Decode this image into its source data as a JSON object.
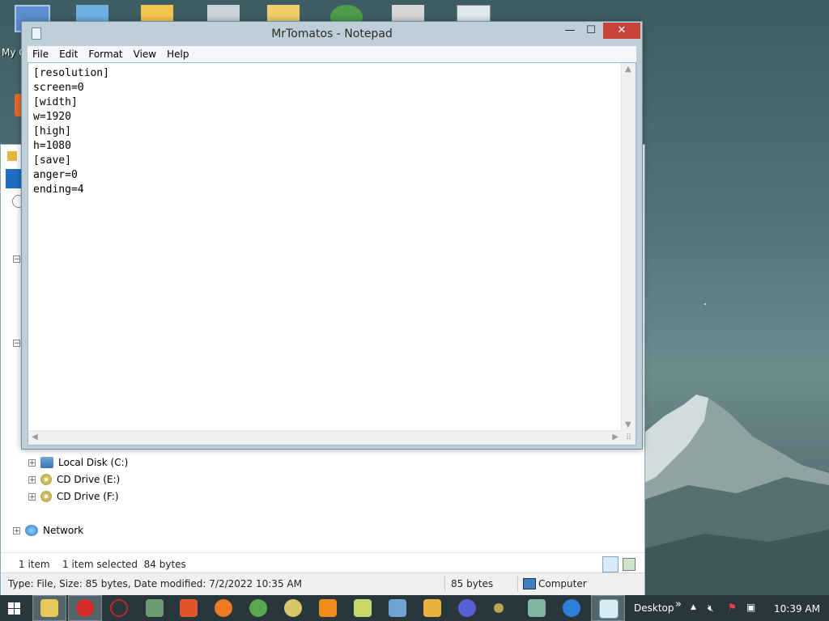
{
  "desktop": {
    "partial_label": "My C",
    "icons": [
      "computer-icon",
      "control-panel-icon",
      "folder-icon",
      "recycle-bin-icon",
      "documents-folder-icon",
      "network-globe-icon",
      "scanner-icon",
      "window-icon"
    ]
  },
  "explorer": {
    "tree": [
      {
        "label": "Local Disk (C:)",
        "icon": "hard-disk-icon"
      },
      {
        "label": "CD Drive (E:)",
        "icon": "cd-drive-icon"
      },
      {
        "label": "CD Drive (F:)",
        "icon": "cd-drive-icon"
      },
      {
        "label": "Network",
        "icon": "network-icon"
      }
    ],
    "status_count": "1 item",
    "status_selected": "1 item selected  84 bytes",
    "details": "Type: File, Size: 85 bytes, Date modified: 7/2/2022 10:35 AM",
    "size": "85 bytes",
    "location": "Computer"
  },
  "notepad": {
    "title": "MrTomatos - Notepad",
    "menu": [
      "File",
      "Edit",
      "Format",
      "View",
      "Help"
    ],
    "content": "[resolution]\nscreen=0\n[width]\nw=1920\n[high]\nh=1080\n[save]\nanger=0\nending=4",
    "minimize_glyph": "—",
    "maximize_glyph": "☐",
    "close_glyph": "✕"
  },
  "taskbar": {
    "start_icon": "windows-start-icon",
    "desktop_label": "Desktop",
    "overflow": "»",
    "time": "10:39 AM",
    "colors": {
      "bar": "#29373d",
      "accent_red": "#c9433a"
    }
  }
}
